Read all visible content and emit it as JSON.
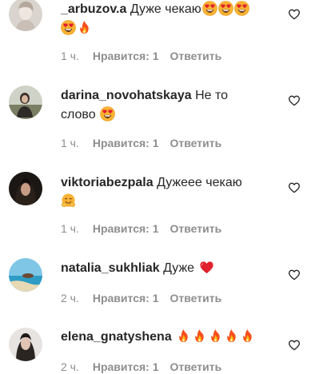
{
  "comments": [
    {
      "username": "_arbuzov.a",
      "text_line1": "Дуже чекаю",
      "emojis_line1": [
        "heart-eyes-emoji",
        "heart-eyes-emoji",
        "heart-eyes-emoji"
      ],
      "emojis_line2": [
        "heart-eyes-emoji",
        "fire-emoji"
      ],
      "time": "1 ч.",
      "likes": "Нравится: 1",
      "reply": "Ответить"
    },
    {
      "username": "darina_novohatskaya",
      "text_line1": "Не то",
      "text_line2": "слово",
      "emojis_line2": [
        "heart-eyes-emoji"
      ],
      "time": "1 ч.",
      "likes": "Нравится: 1",
      "reply": "Ответить"
    },
    {
      "username": "viktoriabezpala",
      "text_line1": "Дужеее чекаю",
      "emojis_line2": [
        "hugging-face-emoji"
      ],
      "time": "1 ч.",
      "likes": "Нравится: 1",
      "reply": "Ответить"
    },
    {
      "username": "natalia_sukhliak",
      "text_line1": "Дуже",
      "emojis_line1": [
        "red-heart-emoji"
      ],
      "time": "2 ч.",
      "likes": "Нравится: 1",
      "reply": "Ответить"
    },
    {
      "username": "elena_gnatyshena",
      "text_line1": "",
      "emojis_line1": [
        "fire-emoji",
        "fire-emoji",
        "fire-emoji",
        "fire-emoji",
        "fire-emoji"
      ],
      "time": "2 ч.",
      "likes": "Нравится: 1",
      "reply": "Ответить"
    }
  ],
  "colors": {
    "text": "#262626",
    "meta": "#8e8e8e"
  }
}
